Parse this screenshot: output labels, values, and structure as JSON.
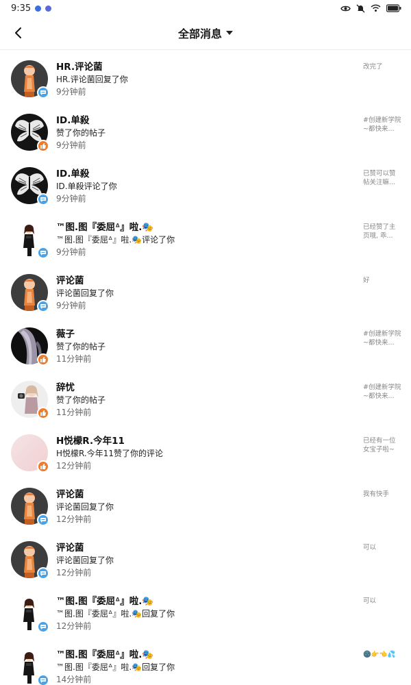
{
  "status": {
    "time": "9:35"
  },
  "header": {
    "title": "全部消息"
  },
  "colors": {
    "comment_badge": "#4aa3e8",
    "like_badge": "#f07c2a"
  },
  "items": [
    {
      "name": "HR.评论菌",
      "action": "HR.评论菌回复了你",
      "time": "9分钟前",
      "preview": "改完了",
      "type": "comment",
      "avatar": "figure-orange-dark"
    },
    {
      "name": "ID.单殺",
      "action": "赞了你的帖子",
      "time": "9分钟前",
      "preview": "#创建新学院~都快来...",
      "type": "like",
      "avatar": "wings-dark"
    },
    {
      "name": "ID.单殺",
      "action": "ID.单殺评论了你",
      "time": "9分钟前",
      "preview": "已赞可以赞帖关注嘛...",
      "type": "comment",
      "avatar": "wings-dark"
    },
    {
      "name": "™图.图『委屈ᐞ』啦.🎭",
      "action": "™图.图『委屈ᐞ』啦.🎭评论了你",
      "time": "9分钟前",
      "preview": "已经赞了主页哦, 乖...",
      "type": "comment",
      "avatar": "figure-black-white"
    },
    {
      "name": "评论菌",
      "action": "评论菌回复了你",
      "time": "9分钟前",
      "preview": "好",
      "type": "comment",
      "avatar": "figure-orange-dark"
    },
    {
      "name": "薇子",
      "action": "赞了你的帖子",
      "time": "11分钟前",
      "preview": "#创建新学院~都快来...",
      "type": "like",
      "avatar": "hair-dark"
    },
    {
      "name": "辞忧",
      "action": "赞了你的帖子",
      "time": "11分钟前",
      "preview": "#创建新学院~都快来...",
      "type": "like",
      "avatar": "figure-light"
    },
    {
      "name": "H悦檬R.今年11",
      "action": "H悦檬R.今年11赞了你的评论",
      "time": "12分钟前",
      "preview": "已经有一位女宝子啦~",
      "type": "like",
      "avatar": "pink"
    },
    {
      "name": "评论菌",
      "action": "评论菌回复了你",
      "time": "12分钟前",
      "preview": "我有快手",
      "type": "comment",
      "avatar": "figure-orange-dark"
    },
    {
      "name": "评论菌",
      "action": "评论菌回复了你",
      "time": "12分钟前",
      "preview": "可以",
      "type": "comment",
      "avatar": "figure-orange-dark"
    },
    {
      "name": "™图.图『委屈ᐞ』啦.🎭",
      "action": "™图.图『委屈ᐞ』啦.🎭回复了你",
      "time": "12分钟前",
      "preview": "可以",
      "type": "comment",
      "avatar": "figure-black-white"
    },
    {
      "name": "™图.图『委屈ᐞ』啦.🎭",
      "action": "™图.图『委屈ᐞ』啦.🎭回复了你",
      "time": "14分钟前",
      "preview": "🌚👉👈💦",
      "type": "comment",
      "avatar": "figure-black-white"
    }
  ]
}
